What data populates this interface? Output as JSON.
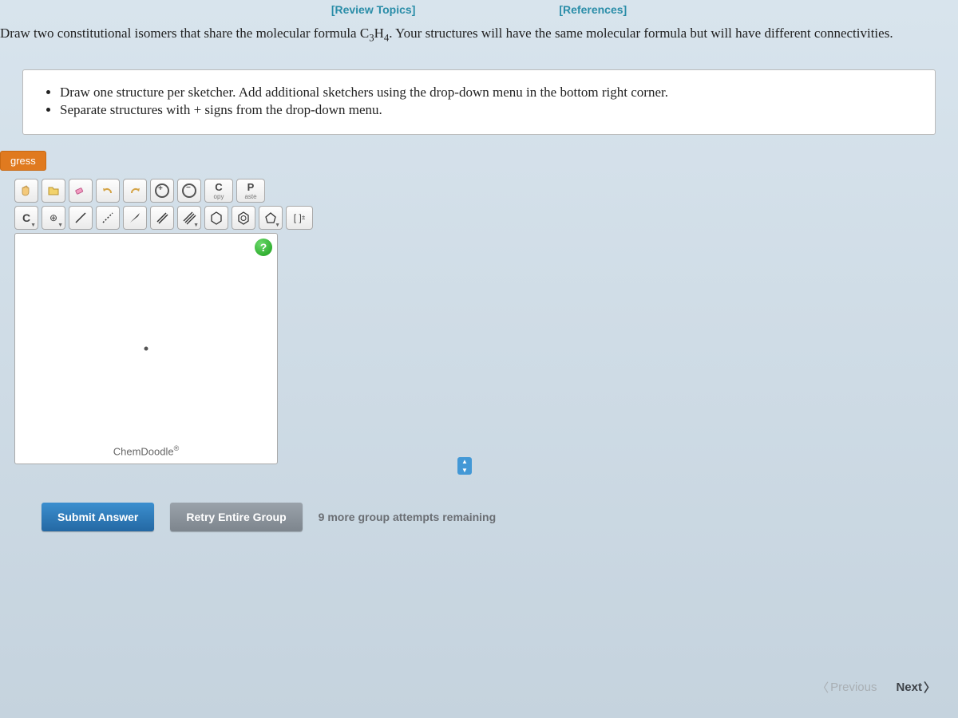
{
  "links": {
    "review": "[Review Topics]",
    "references": "[References]"
  },
  "question": {
    "prefix": "Draw two constitutional isomers that share the molecular formula C",
    "sub1": "3",
    "mid": "H",
    "sub2": "4",
    "suffix": ". Your structures will have the same molecular formula but will have different connectivities."
  },
  "instructions": {
    "item1": "Draw one structure per sketcher. Add additional sketchers using the drop-down menu in the bottom right corner.",
    "item2": "Separate structures with + signs from the drop-down menu."
  },
  "progress_tab": "gress",
  "toolbar": {
    "copy_top": "C",
    "copy_bottom": "opy",
    "paste_top": "P",
    "paste_bottom": "aste",
    "element": "C",
    "charge": "⊕",
    "bracket": "[ ]",
    "bracket_sup": "±"
  },
  "sketcher": {
    "brand": "ChemDoodle",
    "reg": "®",
    "help": "?"
  },
  "actions": {
    "submit": "Submit Answer",
    "retry": "Retry Entire Group",
    "attempts": "9 more group attempts remaining"
  },
  "nav": {
    "previous": "Previous",
    "next": "Next"
  }
}
